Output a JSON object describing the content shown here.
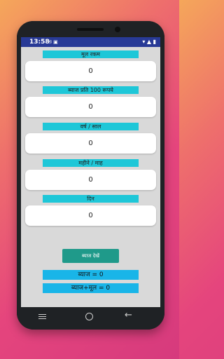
{
  "status": {
    "time": "13:58",
    "left_icons": "✉ ▣",
    "right_icons": "▾ ▲ ▮"
  },
  "fields": [
    {
      "label": "मूल रकम",
      "value": "0"
    },
    {
      "label": "ब्याज प्रति 100 रूपये",
      "value": "0"
    },
    {
      "label": "वर्ष / साल",
      "value": "0"
    },
    {
      "label": "महीने / माह",
      "value": "0"
    },
    {
      "label": "दिन",
      "value": "0"
    }
  ],
  "calculate_button": "ब्याज देखें",
  "results": {
    "interest": "ब्याज = 0",
    "total": "ब्याज+मूल  = 0"
  },
  "colors": {
    "statusbar": "#283a96",
    "label_bar": "#1ec7d8",
    "button": "#1f9a8a",
    "result_bar": "#19b5e8",
    "screen_bg": "#d9d9d9"
  },
  "icons": [
    "nav-menu-icon",
    "nav-home-icon",
    "nav-back-icon"
  ]
}
